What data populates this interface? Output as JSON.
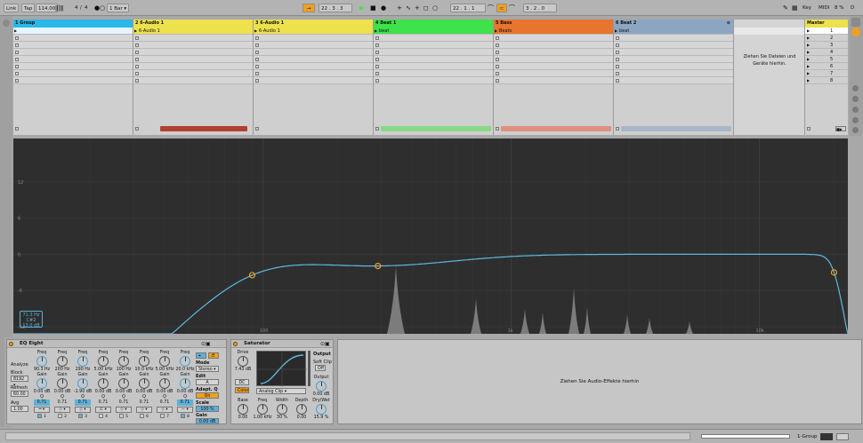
{
  "transport": {
    "link": "Link",
    "tap": "Tap",
    "tempo": "114.00",
    "sig_num": "4",
    "sig_den": "4",
    "quant": "1 Bar",
    "pos": "22 .  3 .  3",
    "loop_start": "22 .  1 .  1",
    "loop_len": "3 .  2 .  0",
    "key": "Key",
    "midi": "MIDI",
    "cpu": "8 %",
    "disk": "D"
  },
  "tracks": [
    {
      "name": "1 Group",
      "color": "#29b8e8",
      "clips": [],
      "meter": ""
    },
    {
      "name": "2 6-Audio 1",
      "color": "#ede14c",
      "clips": [
        "6-Audio 1"
      ],
      "meter": "#b04030"
    },
    {
      "name": "3 6-Audio 1",
      "color": "#ede14c",
      "clips": [
        "6-Audio 1"
      ],
      "meter": ""
    },
    {
      "name": "4 Beat 1",
      "color": "#3ee24a",
      "clips": [
        "beat"
      ],
      "meter": "#88d888"
    },
    {
      "name": "5 Bass",
      "color": "#e8742e",
      "clips": [
        "Beats"
      ],
      "meter": "#e09080"
    },
    {
      "name": "6 Beat 2",
      "color": "#8ca6c2",
      "clips": [
        "beat"
      ],
      "meter": "#a8b8c8"
    }
  ],
  "session_drop": "Ziehen Sie Dateien und Geräte hierhin.",
  "master": {
    "name": "Master",
    "color": "#ede14c",
    "scenes": [
      "1",
      "2",
      "3",
      "4",
      "5",
      "6",
      "7",
      "8"
    ]
  },
  "eq_display": {
    "y_labels": [
      "12",
      "6",
      "0",
      "-6",
      "-12"
    ],
    "x_labels": [
      "100",
      "1k",
      "10k"
    ],
    "readout": [
      "71.3 Hz",
      "C#2",
      "13.0 dB"
    ],
    "curve_color": "#5fb8e0",
    "spectrum_color": "#8a8a8a"
  },
  "eq_eight": {
    "title": "EQ Eight",
    "analyze": "Analyze",
    "block": "Block",
    "block_val": "8192",
    "refresh": "Refresh",
    "refresh_val": "60.00",
    "avg": "Avg",
    "avg_val": "1.00",
    "freq_label": "Freq",
    "gain_label": "Gain",
    "q_label": "Q",
    "bands": [
      {
        "num": "1",
        "freq": "90.3 Hz",
        "gain": "0.00 dB",
        "q": "0.71",
        "on": true,
        "type": "═"
      },
      {
        "num": "2",
        "freq": "200 Hz",
        "gain": "0.00 dB",
        "q": "0.71",
        "on": false,
        "type": "◇"
      },
      {
        "num": "3",
        "freq": "290 Hz",
        "gain": "-1.90 dB",
        "q": "0.71",
        "on": true,
        "type": "◇"
      },
      {
        "num": "4",
        "freq": "5.00 kHz",
        "gain": "0.00 dB",
        "q": "0.71",
        "on": false,
        "type": "⊏"
      },
      {
        "num": "5",
        "freq": "100 Hz",
        "gain": "0.00 dB",
        "q": "0.71",
        "on": false,
        "type": "◇"
      },
      {
        "num": "6",
        "freq": "10.0 kHz",
        "gain": "0.00 dB",
        "q": "0.71",
        "on": false,
        "type": "◇"
      },
      {
        "num": "7",
        "freq": "5.00 kHz",
        "gain": "0.00 dB",
        "q": "0.71",
        "on": false,
        "type": "◇"
      },
      {
        "num": "8",
        "freq": "20.0 kHz",
        "gain": "0.00 dB",
        "q": "0.71",
        "on": true,
        "type": "⌐"
      }
    ],
    "mode": "Mode",
    "mode_val": "Stereo",
    "edit": "Edit",
    "edit_val": "A",
    "adapt_q": "Adapt. Q",
    "adapt_q_val": "On",
    "scale": "Scale",
    "scale_val": "100 %",
    "gain": "Gain",
    "gain_val": "0.00 dB"
  },
  "saturator": {
    "title": "Saturator",
    "drive": "Drive",
    "drive_val": "7.43 dB",
    "dc": "DC",
    "color": "Color",
    "type_val": "Analog Clip",
    "output_section": "Output",
    "soft_clip": "Soft Clip",
    "soft_clip_val": "Off",
    "output": "Output",
    "output_val": "0.00 dB",
    "drywet": "Dry/Wet",
    "drywet_val": "15.9 %",
    "base": "Base",
    "base_val": "0.00",
    "freq": "Freq",
    "freq_val": "1.00 kHz",
    "width": "Width",
    "width_val": "30 %",
    "depth": "Depth",
    "depth_val": "0.00"
  },
  "device_drop": "Ziehen Sie Audio-Effekte hierhin",
  "bottombar": {
    "track": "1-Group"
  }
}
